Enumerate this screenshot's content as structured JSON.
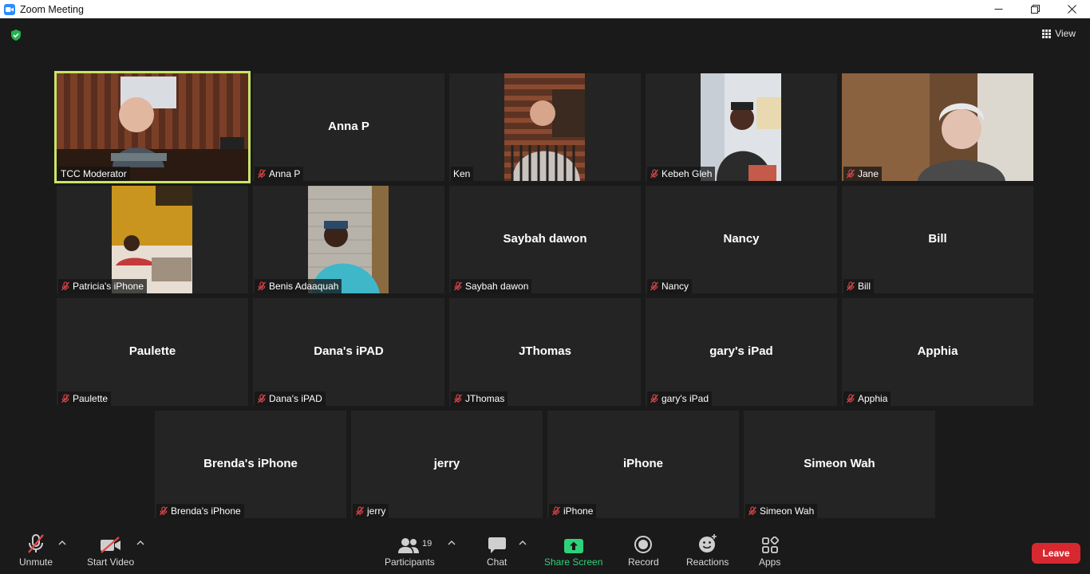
{
  "window": {
    "title": "Zoom Meeting",
    "app_color": "#2d8cff"
  },
  "header": {
    "view_label": "View",
    "encryption_icon": "shield-check-icon"
  },
  "tiles": [
    {
      "id": "tcc",
      "label": "TCC Moderator",
      "big": "",
      "muted": false,
      "video": "moderator",
      "active": true
    },
    {
      "id": "anna",
      "label": "Anna P",
      "big": "Anna P",
      "muted": true,
      "video": null,
      "active": false
    },
    {
      "id": "ken",
      "label": "Ken",
      "big": "",
      "muted": false,
      "video": "ken",
      "active": false
    },
    {
      "id": "kebeh",
      "label": "Kebeh Gleh",
      "big": "",
      "muted": true,
      "video": "kebeh",
      "active": false
    },
    {
      "id": "jane",
      "label": "Jane",
      "big": "",
      "muted": true,
      "video": "jane",
      "active": false
    },
    {
      "id": "patricia",
      "label": "Patricia's iPhone",
      "big": "",
      "muted": true,
      "video": "patricia",
      "active": false
    },
    {
      "id": "benis",
      "label": "Benis Adaaquah",
      "big": "",
      "muted": true,
      "video": "benis",
      "active": false
    },
    {
      "id": "saybah",
      "label": "Saybah dawon",
      "big": "Saybah dawon",
      "muted": true,
      "video": null,
      "active": false
    },
    {
      "id": "nancy",
      "label": "Nancy",
      "big": "Nancy",
      "muted": true,
      "video": null,
      "active": false
    },
    {
      "id": "bill",
      "label": "Bill",
      "big": "Bill",
      "muted": true,
      "video": null,
      "active": false
    },
    {
      "id": "paulette",
      "label": "Paulette",
      "big": "Paulette",
      "muted": true,
      "video": null,
      "active": false
    },
    {
      "id": "dana",
      "label": "Dana's iPAD",
      "big": "Dana's iPAD",
      "muted": true,
      "video": null,
      "active": false
    },
    {
      "id": "jthomas",
      "label": "JThomas",
      "big": "JThomas",
      "muted": true,
      "video": null,
      "active": false
    },
    {
      "id": "gary",
      "label": "gary's iPad",
      "big": "gary's iPad",
      "muted": true,
      "video": null,
      "active": false
    },
    {
      "id": "apphia",
      "label": "Apphia",
      "big": "Apphia",
      "muted": true,
      "video": null,
      "active": false
    },
    {
      "id": "brenda",
      "label": "Brenda's iPhone",
      "big": "Brenda's iPhone",
      "muted": true,
      "video": null,
      "active": false
    },
    {
      "id": "jerry",
      "label": "jerry",
      "big": "jerry",
      "muted": true,
      "video": null,
      "active": false
    },
    {
      "id": "iphone",
      "label": "iPhone",
      "big": "iPhone",
      "muted": true,
      "video": null,
      "active": false
    },
    {
      "id": "simeon",
      "label": "Simeon Wah",
      "big": "Simeon Wah",
      "muted": true,
      "video": null,
      "active": false
    }
  ],
  "toolbar": {
    "unmute": "Unmute",
    "start_video": "Start Video",
    "participants": "Participants",
    "participants_count": "19",
    "chat": "Chat",
    "share_screen": "Share Screen",
    "record": "Record",
    "reactions": "Reactions",
    "apps": "Apps",
    "leave": "Leave"
  },
  "colors": {
    "active_speaker_border": "#c9e46a",
    "share_screen_green": "#2fd27a",
    "leave_red": "#d8282f",
    "muted_red": "#e5484d"
  }
}
